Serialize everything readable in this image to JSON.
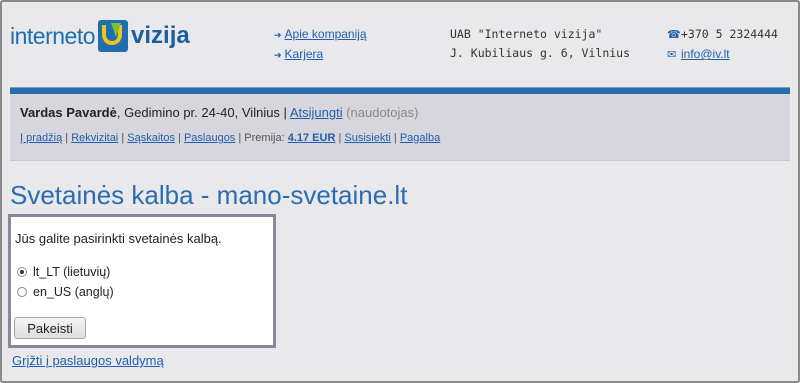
{
  "logo": {
    "word1": "interneto",
    "word2": "vizija"
  },
  "nav": {
    "link1": "Apie kompaniją",
    "link2": "Karjera"
  },
  "company": {
    "line1": "UAB \"Interneto vizija\"",
    "line2": "J. Kubiliaus g. 6, Vilnius"
  },
  "contacts": {
    "phone": "+370 5 2324444",
    "email": "info@iv.lt"
  },
  "user": {
    "name": "Vardas Pavardė",
    "address": ", Gedimino pr. 24-40, Vilnius | ",
    "logout": "Atsijungti",
    "role": "(naudotojas)"
  },
  "menu": {
    "items": [
      "Į pradžią",
      "Rekvizitai",
      "Sąskaitos",
      "Paslaugos"
    ],
    "premium_label": "Premija:",
    "premium_value": "4.17 EUR",
    "items2": [
      "Susisiekti",
      "Pagalba"
    ]
  },
  "page": {
    "title": "Svetainės kalba - mano-svetaine.lt",
    "prompt": "Jūs galite pasirinkti svetainės kalbą.",
    "options": [
      {
        "label": "lt_LT (lietuvių)",
        "selected": true
      },
      {
        "label": "en_US (anglų)",
        "selected": false
      }
    ],
    "submit": "Pakeisti",
    "back": "Grįžti į paslaugos valdymą"
  },
  "colors": {
    "accent": "#2a6db3",
    "bar": "#2b6bb0",
    "logo_yellow": "#f0c419",
    "logo_green": "#7cbf3a"
  }
}
